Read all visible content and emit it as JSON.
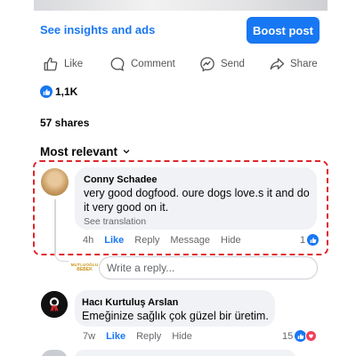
{
  "post_actions": {
    "insights_label": "See insights and ads",
    "boost_label": "Boost post",
    "like_label": "Like",
    "comment_label": "Comment",
    "send_label": "Send",
    "share_label": "Share"
  },
  "stats": {
    "reactions_count": "1,1K",
    "shares_label": "57 shares"
  },
  "comments": {
    "sort_label": "Most relevant",
    "items": [
      {
        "author": "Conny Schadee",
        "text_line1": "very good dogfood. oure dogs love.s it and do",
        "text_line2": "it very good on it.",
        "see_translation": "See translation",
        "time": "4h",
        "like_label": "Like",
        "reply_label": "Reply",
        "message_label": "Message",
        "hide_label": "Hide",
        "reaction_count": "1",
        "highlighted": true
      },
      {
        "author": "Hacı Kurtuluş Arslan",
        "text": "Emeğinize sağlık çok güzel bir üretim.",
        "time": "7w",
        "like_label": "Like",
        "reply_label": "Reply",
        "hide_label": "Hide",
        "reaction_count": "15"
      }
    ]
  },
  "reply_box": {
    "placeholder": "Write a reply...",
    "page_avatar_line1": "MUTLUOĞLU",
    "page_avatar_line2": "BEBEK"
  },
  "colors": {
    "accent": "#1877f2",
    "highlight_border": "#e0252b",
    "bubble_bg": "#f0f2f5",
    "muted_text": "#65676b",
    "love": "#f33e58"
  }
}
